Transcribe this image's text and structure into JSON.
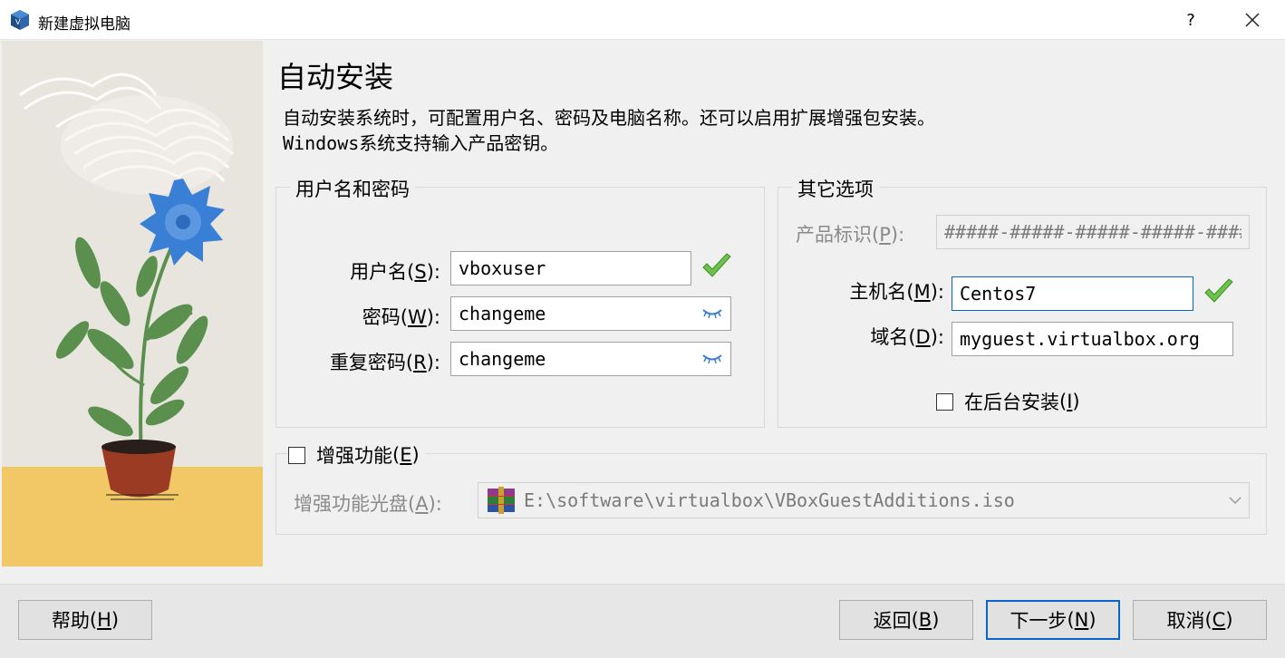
{
  "window": {
    "title": "新建虚拟电脑",
    "help_glyph": "?"
  },
  "page": {
    "title": "自动安装",
    "description_line1": "自动安装系统时，可配置用户名、密码及电脑名称。还可以启用扩展增强包安装。",
    "description_line2": "Windows系统支持输入产品密钥。"
  },
  "user_group": {
    "legend": "用户名和密码",
    "username_label": "用户名",
    "username_key": "S",
    "username_value": "vboxuser",
    "password_label": "密码",
    "password_key": "W",
    "password_value": "changeme",
    "repeat_label": "重复密码",
    "repeat_key": "R",
    "repeat_value": "changeme"
  },
  "other_group": {
    "legend": "其它选项",
    "product_key_label": "产品标识",
    "product_key_key": "P",
    "product_key_value": "#####-#####-#####-#####-#####",
    "hostname_label": "主机名",
    "hostname_key": "M",
    "hostname_value": "Centos7",
    "domain_label": "域名",
    "domain_key": "D",
    "domain_value": "myguest.virtualbox.org",
    "background_install_label": "在后台安装",
    "background_install_key": "I",
    "background_install_checked": false
  },
  "additions": {
    "label": "增强功能",
    "key": "E",
    "checked": false,
    "iso_label": "增强功能光盘",
    "iso_key": "A",
    "iso_value": "E:\\software\\virtualbox\\VBoxGuestAdditions.iso"
  },
  "footer": {
    "help_label": "帮助",
    "help_key": "H",
    "back_label": "返回",
    "back_key": "B",
    "next_label": "下一步",
    "next_key": "N",
    "cancel_label": "取消",
    "cancel_key": "C"
  },
  "colors": {
    "accent": "#0a63c9",
    "valid_check": "#6cc24a",
    "art_floor": "#f2c766",
    "flower": "#3a7fd6",
    "leaf": "#5a8f4e",
    "pot": "#9c3b23"
  },
  "icons": [
    "virtualbox-icon",
    "close-icon",
    "checkmark-icon",
    "eye-closed-icon",
    "winrar-icon",
    "chevron-down-icon"
  ]
}
